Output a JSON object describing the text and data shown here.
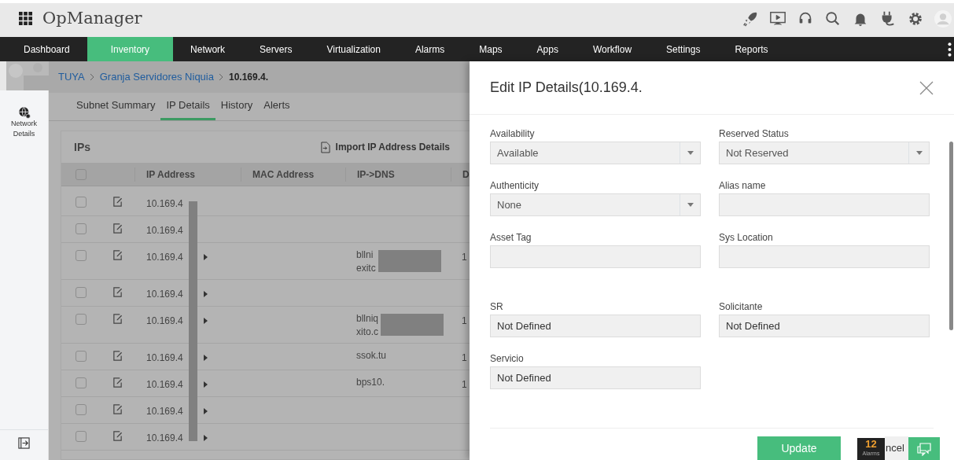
{
  "app": {
    "title": "OpManager"
  },
  "nav": [
    {
      "label": "Dashboard",
      "selected": false
    },
    {
      "label": "Inventory",
      "selected": true
    },
    {
      "label": "Network",
      "selected": false
    },
    {
      "label": "Servers",
      "selected": false
    },
    {
      "label": "Virtualization",
      "selected": false
    },
    {
      "label": "Alarms",
      "selected": false
    },
    {
      "label": "Maps",
      "selected": false
    },
    {
      "label": "Apps",
      "selected": false
    },
    {
      "label": "Workflow",
      "selected": false
    },
    {
      "label": "Settings",
      "selected": false
    },
    {
      "label": "Reports",
      "selected": false
    }
  ],
  "sidebar": {
    "items": [
      {
        "label": "Network Details"
      }
    ]
  },
  "breadcrumb": [
    "TUYA",
    "Granja Servidores Niquia",
    "10.169.4."
  ],
  "tabs": [
    {
      "label": "Subnet Summary",
      "selected": false
    },
    {
      "label": "IP Details",
      "selected": true
    },
    {
      "label": "History",
      "selected": false
    },
    {
      "label": "Alerts",
      "selected": false
    }
  ],
  "panel": {
    "title": "IPs",
    "import_action": "Import IP Address Details"
  },
  "table": {
    "select_all_checked": false,
    "columns": [
      "IP Address",
      "MAC Address",
      "IP->DNS",
      "D"
    ],
    "rows": [
      {
        "checked": false,
        "ip": "10.169.4",
        "expandable": false
      },
      {
        "checked": false,
        "ip": "10.169.4",
        "expandable": false
      },
      {
        "checked": false,
        "ip": "10.169.4",
        "expandable": true,
        "dns": [
          "bllni",
          "exitc"
        ],
        "dns_redacted": true,
        "column_4": "1"
      },
      {
        "checked": false,
        "ip": "10.169.4",
        "expandable": true
      },
      {
        "checked": false,
        "ip": "10.169.4",
        "expandable": true,
        "dns": [
          "bllniq",
          "xito.c"
        ],
        "dns_redacted": true,
        "column_4": "1"
      },
      {
        "checked": false,
        "ip": "10.169.4",
        "expandable": true,
        "dns": [
          "ssok.tu"
        ],
        "dns_redacted": false,
        "column_4": "1"
      },
      {
        "checked": false,
        "ip": "10.169.4",
        "expandable": true,
        "dns": [
          "bps10."
        ],
        "dns_redacted": false,
        "column_4": "1"
      },
      {
        "checked": false,
        "ip": "10.169.4",
        "expandable": true
      },
      {
        "checked": false,
        "ip": "10.169.4",
        "expandable": true
      }
    ]
  },
  "drawer": {
    "title": "Edit IP Details(10.169.4.",
    "fields": [
      {
        "label": "Availability",
        "kind": "select",
        "value": "Available"
      },
      {
        "label": "Reserved Status",
        "kind": "select",
        "value": "Not Reserved"
      },
      {
        "label": "Authenticity",
        "kind": "select",
        "value": "None"
      },
      {
        "label": "Alias name",
        "kind": "text"
      },
      {
        "label": "Asset Tag",
        "kind": "text"
      },
      {
        "label": "Sys Location",
        "kind": "text"
      },
      {
        "label": "SR",
        "kind": "text",
        "value": "Not Defined"
      },
      {
        "label": "Solicitante",
        "kind": "text",
        "value": "Not Defined"
      },
      {
        "label": "Servicio",
        "kind": "text",
        "value": "Not Defined"
      }
    ],
    "buttons": [
      {
        "label": "Update",
        "kind": "primary"
      },
      {
        "label": "ncel",
        "kind": "secondary"
      }
    ]
  },
  "alarm_badge": {
    "count": "12",
    "label": "Alarms"
  }
}
